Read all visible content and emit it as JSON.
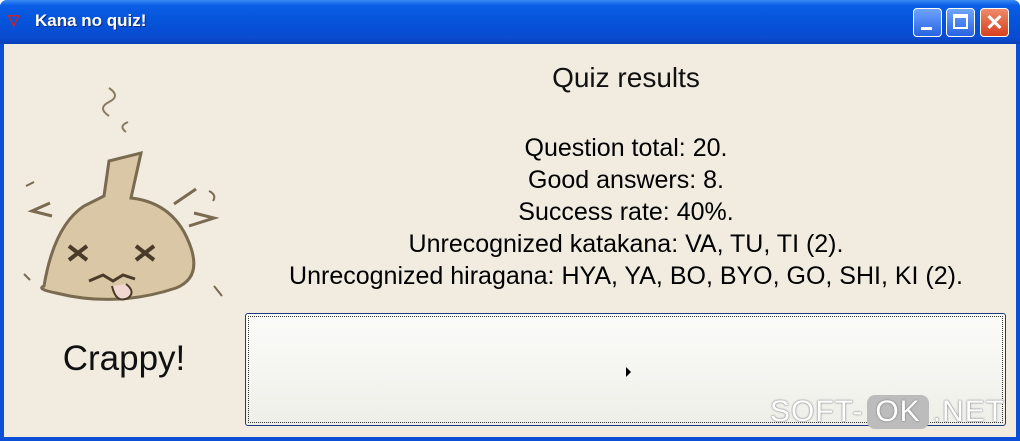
{
  "window": {
    "title": "Kana no quiz!"
  },
  "results": {
    "heading": "Quiz results",
    "lines": [
      "Question total: 20.",
      "Good answers: 8.",
      "Success rate: 40%.",
      "Unrecognized katakana: VA, TU, TI (2).",
      "Unrecognized hiragana: HYA, YA, BO, BYO, GO, SHI, KI (2)."
    ],
    "verdict": "Crappy!"
  },
  "continue_button": {
    "icon": "play-arrow-icon"
  },
  "mascot": {
    "icon": "dizzy-mascot-icon"
  },
  "watermark": {
    "pre": "SOFT-",
    "ok": "OK",
    "post": ".NET"
  },
  "colors": {
    "titlebar": "#0553d9",
    "client_bg": "#f1ebe0",
    "text": "#111111"
  }
}
